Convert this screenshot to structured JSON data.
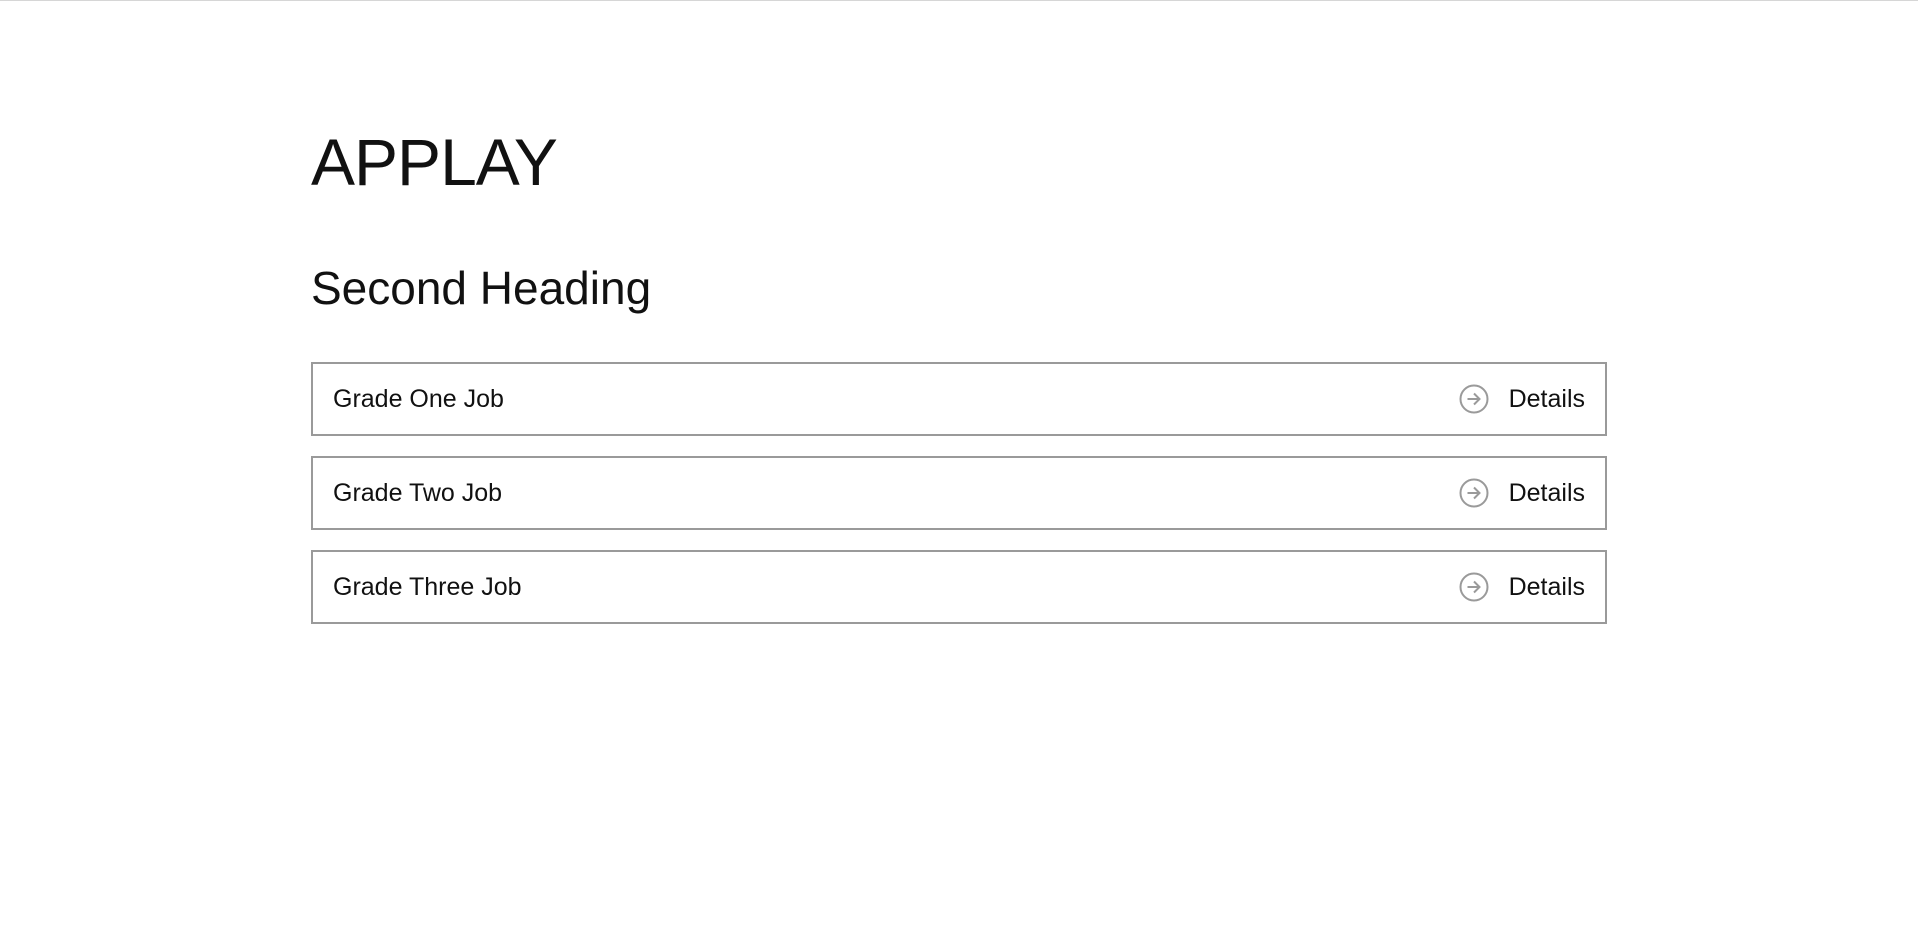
{
  "header": {
    "title": "APPLAY"
  },
  "main": {
    "heading": "Second Heading",
    "jobs": [
      {
        "title": "Grade One Job",
        "action_label": "Details",
        "action_icon": "arrow-right-circle-icon"
      },
      {
        "title": "Grade Two Job",
        "action_label": "Details",
        "action_icon": "arrow-right-circle-icon"
      },
      {
        "title": "Grade Three Job",
        "action_label": "Details",
        "action_icon": "arrow-right-circle-icon"
      }
    ]
  },
  "colors": {
    "text": "#111111",
    "border": "#9a9a9a",
    "icon": "#9a9a9a",
    "background": "#ffffff"
  }
}
